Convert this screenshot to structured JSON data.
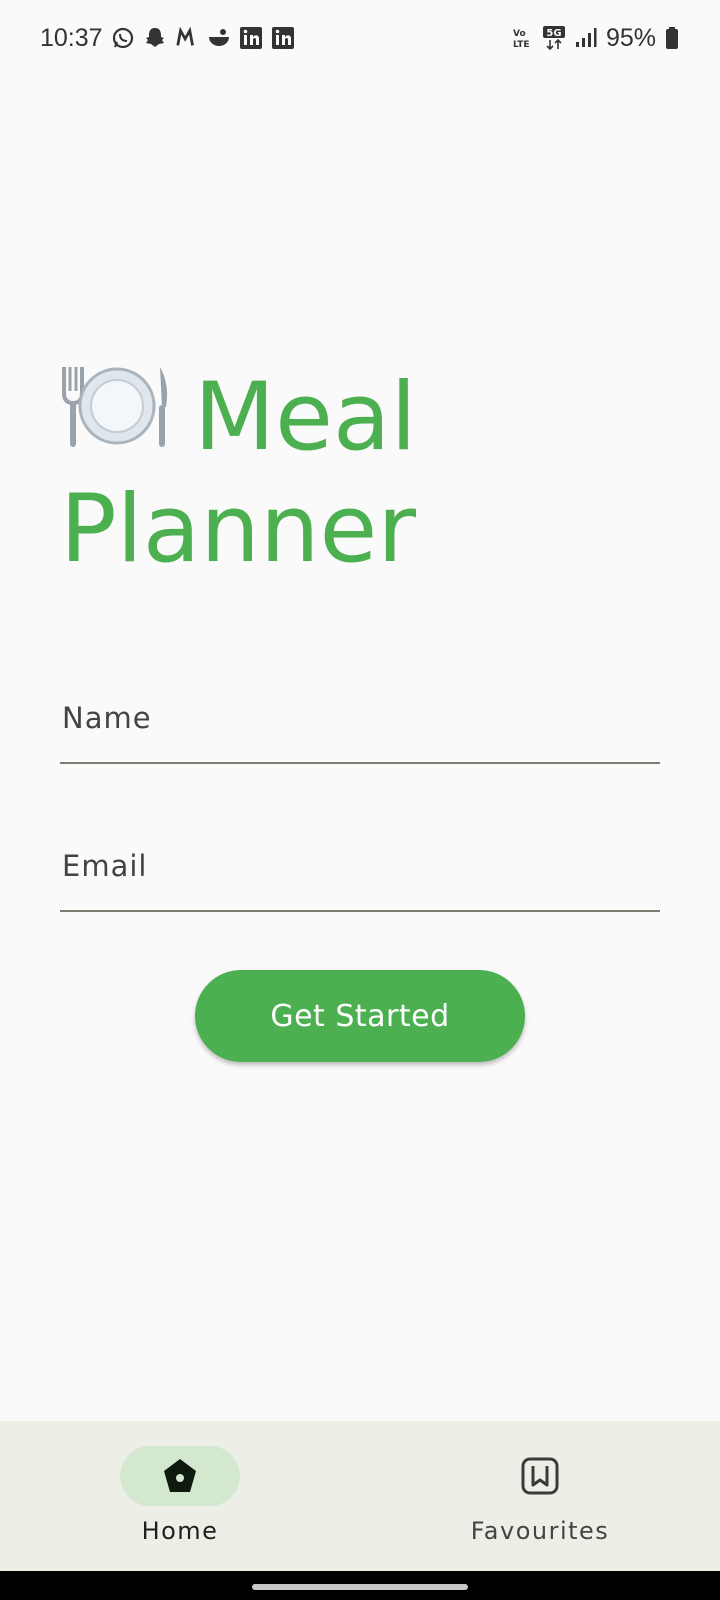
{
  "status_bar": {
    "time": "10:37",
    "notification_icons": [
      "whatsapp-icon",
      "snapchat-icon",
      "myntra-icon",
      "food-icon",
      "linkedin-icon",
      "linkedin-icon"
    ],
    "network": "5G",
    "battery": "95%"
  },
  "app": {
    "title_line1": "Meal",
    "title_line2": "Planner",
    "brand_color": "#4caf50"
  },
  "form": {
    "name_placeholder": "Name",
    "email_placeholder": "Email",
    "submit_label": "Get Started"
  },
  "bottom_nav": {
    "items": [
      {
        "label": "Home",
        "icon": "home-icon",
        "active": true
      },
      {
        "label": "Favourites",
        "icon": "bookmark-icon",
        "active": false
      }
    ]
  }
}
